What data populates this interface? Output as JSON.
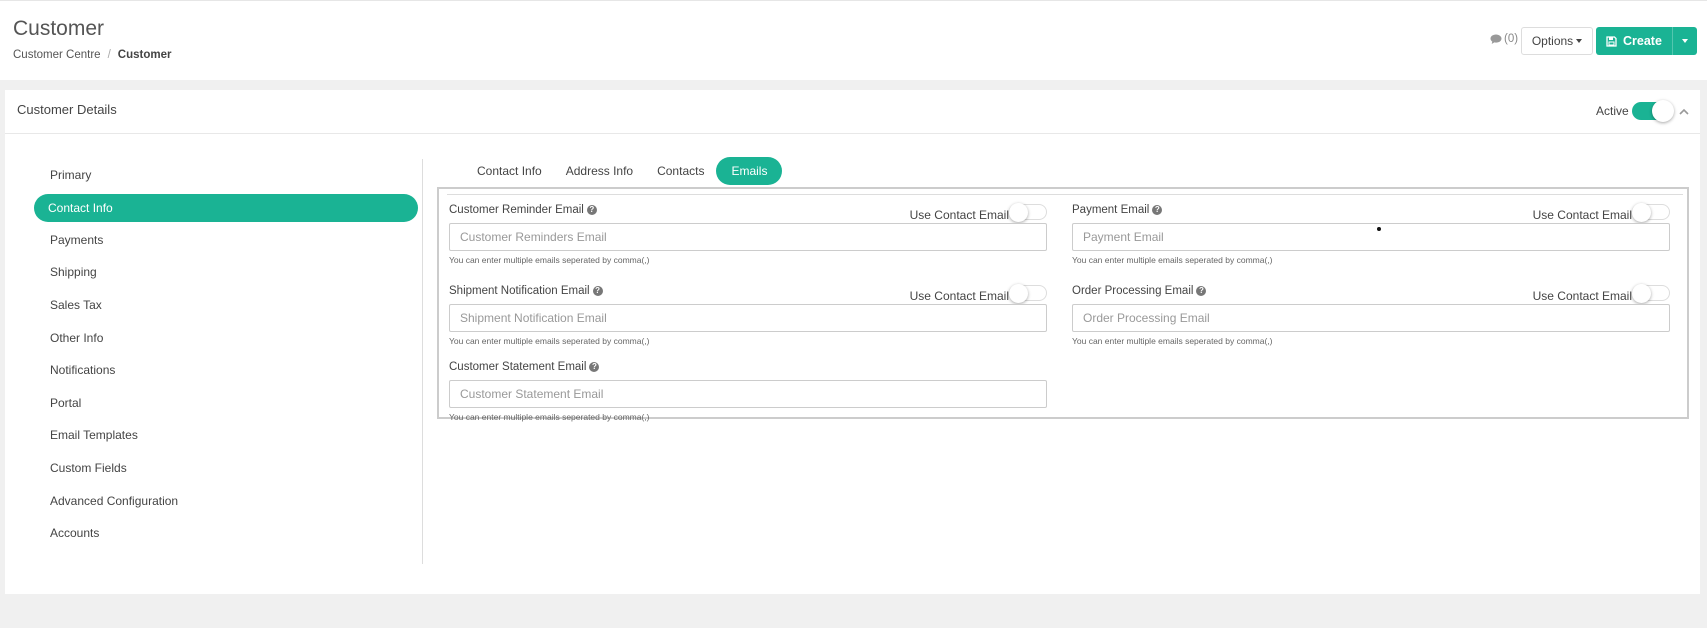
{
  "header": {
    "title": "Customer",
    "breadcrumb": [
      "Customer Centre",
      "Customer"
    ],
    "breadcrumb_sep": "/",
    "comments_count": "(0)",
    "options_label": "Options",
    "create_label": "Create"
  },
  "card": {
    "title": "Customer Details",
    "active_label": "Active",
    "active": true
  },
  "sidebar": {
    "items": [
      {
        "label": "Primary"
      },
      {
        "label": "Contact Info",
        "active": true
      },
      {
        "label": "Payments"
      },
      {
        "label": "Shipping"
      },
      {
        "label": "Sales Tax"
      },
      {
        "label": "Other Info"
      },
      {
        "label": "Notifications"
      },
      {
        "label": "Portal"
      },
      {
        "label": "Email Templates"
      },
      {
        "label": "Custom Fields"
      },
      {
        "label": "Advanced Configuration"
      },
      {
        "label": "Accounts"
      }
    ]
  },
  "tabs": [
    {
      "label": "Contact Info"
    },
    {
      "label": "Address Info"
    },
    {
      "label": "Contacts"
    },
    {
      "label": "Emails",
      "active": true
    }
  ],
  "emails": {
    "use_contact_label": "Use Contact Email",
    "hint": "You can enter multiple emails seperated by comma(,)",
    "fields": {
      "customer_reminder": {
        "label": "Customer Reminder Email",
        "placeholder": "Customer Reminders Email",
        "value": "",
        "use_contact": false
      },
      "payment": {
        "label": "Payment Email",
        "placeholder": "Payment Email",
        "value": "",
        "use_contact": false
      },
      "shipment_notification": {
        "label": "Shipment Notification Email",
        "placeholder": "Shipment Notification Email",
        "value": "",
        "use_contact": false
      },
      "order_processing": {
        "label": "Order Processing Email",
        "placeholder": "Order Processing Email",
        "value": "",
        "use_contact": false
      },
      "customer_statement": {
        "label": "Customer Statement Email",
        "placeholder": "Customer Statement Email",
        "value": ""
      }
    }
  },
  "colors": {
    "accent": "#1ab394"
  }
}
